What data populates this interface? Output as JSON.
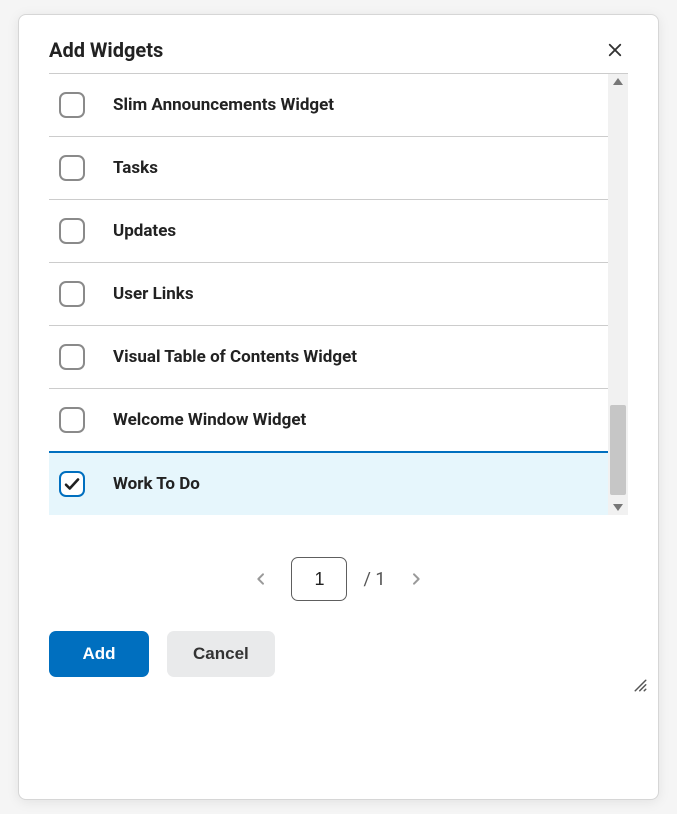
{
  "dialog": {
    "title": "Add Widgets"
  },
  "widgets": [
    {
      "label": "Slim Announcements Widget",
      "checked": false
    },
    {
      "label": "Tasks",
      "checked": false
    },
    {
      "label": "Updates",
      "checked": false
    },
    {
      "label": "User Links",
      "checked": false
    },
    {
      "label": "Visual Table of Contents Widget",
      "checked": false
    },
    {
      "label": "Welcome Window Widget",
      "checked": false
    },
    {
      "label": "Work To Do",
      "checked": true
    }
  ],
  "pagination": {
    "current": "1",
    "total": "1",
    "separator": "/"
  },
  "footer": {
    "add_label": "Add",
    "cancel_label": "Cancel"
  }
}
